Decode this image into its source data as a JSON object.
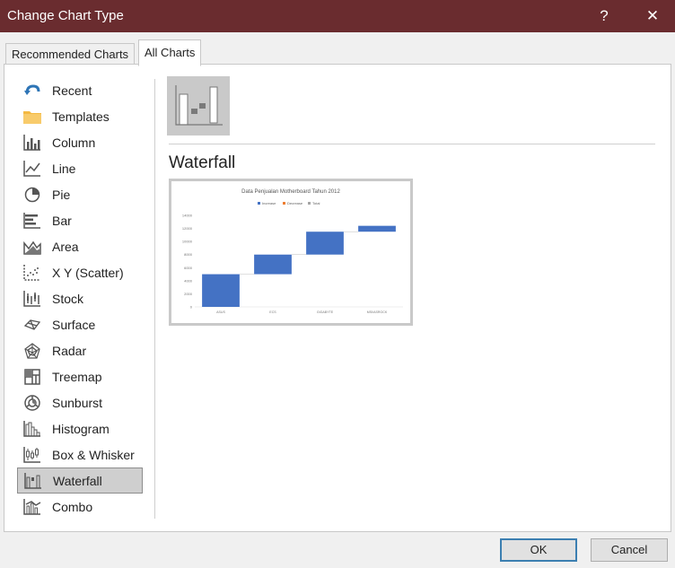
{
  "window": {
    "title": "Change Chart Type",
    "help_label": "?",
    "close_label": "✕"
  },
  "tabs": [
    {
      "label": "Recommended Charts"
    },
    {
      "label": "All Charts"
    }
  ],
  "sidebar": {
    "items": [
      {
        "label": "Recent",
        "icon": "recent-icon"
      },
      {
        "label": "Templates",
        "icon": "templates-folder-icon"
      },
      {
        "label": "Column",
        "icon": "column-chart-icon"
      },
      {
        "label": "Line",
        "icon": "line-chart-icon"
      },
      {
        "label": "Pie",
        "icon": "pie-chart-icon"
      },
      {
        "label": "Bar",
        "icon": "bar-chart-icon"
      },
      {
        "label": "Area",
        "icon": "area-chart-icon"
      },
      {
        "label": "X Y (Scatter)",
        "icon": "scatter-chart-icon"
      },
      {
        "label": "Stock",
        "icon": "stock-chart-icon"
      },
      {
        "label": "Surface",
        "icon": "surface-chart-icon"
      },
      {
        "label": "Radar",
        "icon": "radar-chart-icon"
      },
      {
        "label": "Treemap",
        "icon": "treemap-chart-icon"
      },
      {
        "label": "Sunburst",
        "icon": "sunburst-chart-icon"
      },
      {
        "label": "Histogram",
        "icon": "histogram-chart-icon"
      },
      {
        "label": "Box & Whisker",
        "icon": "box-whisker-chart-icon"
      },
      {
        "label": "Waterfall",
        "icon": "waterfall-chart-icon"
      },
      {
        "label": "Combo",
        "icon": "combo-chart-icon"
      }
    ],
    "selected": "Waterfall"
  },
  "main": {
    "chart_type_title": "Waterfall",
    "preview": {
      "title": "Data Penjualan Motherboard Tahun 2012",
      "legend": [
        "Increase",
        "Decrease",
        "Total"
      ],
      "colors": {
        "increase": "#4472c4",
        "decrease": "#ed7d31",
        "total": "#a5a5a5"
      },
      "y_ticks": [
        "14000",
        "12000",
        "10000",
        "8000",
        "6000",
        "4000",
        "2000",
        "0"
      ],
      "categories": [
        "ASUS",
        "ECS",
        "GIGABYTE",
        "MSI/ASROCK"
      ]
    }
  },
  "chart_data": {
    "type": "waterfall",
    "title": "Data Penjualan Motherboard Tahun 2012",
    "categories": [
      "ASUS",
      "ECS",
      "GIGABYTE",
      "MSI/ASROCK"
    ],
    "values": [
      5000,
      3000,
      3500,
      900
    ],
    "ylim": [
      0,
      14000
    ],
    "legend": [
      "Increase",
      "Decrease",
      "Total"
    ],
    "legend_position": "top"
  },
  "buttons": {
    "ok": "OK",
    "cancel": "Cancel"
  }
}
